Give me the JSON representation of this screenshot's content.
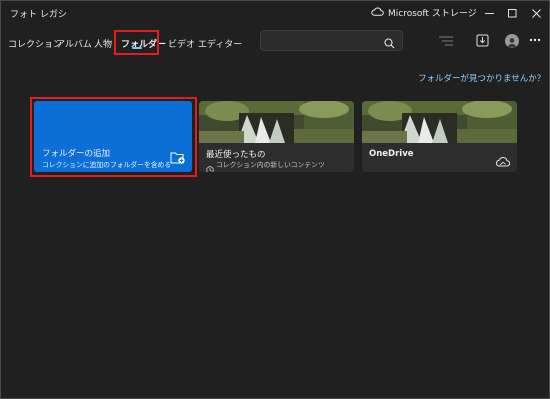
{
  "app": {
    "title": "フォト レガシ"
  },
  "store": {
    "label": "Microsoft ストレージ"
  },
  "nav": {
    "tabs": [
      {
        "label": "コレクション"
      },
      {
        "label": "アルバム"
      },
      {
        "label": "人物"
      },
      {
        "label": "フォルダー"
      },
      {
        "label": "ビデオ エディター"
      }
    ],
    "active_tab": "フォルダー"
  },
  "search": {
    "value": "",
    "placeholder": ""
  },
  "folders": {
    "missing_link": "フォルダーが見つかりませんか？",
    "add_card": {
      "title": "フォルダーの追加",
      "subtitle": "コレクションに追加のフォルダーを含める"
    },
    "recent_card": {
      "title": "最近使ったもの",
      "subtitle": "コレクション内の新しいコンテンツ"
    },
    "onedrive_card": {
      "title": "OneDrive"
    }
  },
  "colors": {
    "accent": "#0b6fd6",
    "highlight": "#e01e1e",
    "link": "#8fd1ff",
    "background": "#202020"
  },
  "icons": [
    "cloud-icon",
    "minimize-icon",
    "maximize-icon",
    "close-icon",
    "search-icon",
    "filter-icon",
    "import-icon",
    "avatar-icon",
    "more-icon",
    "folder-add-icon",
    "clock-icon",
    "onedrive-cloud-icon"
  ]
}
